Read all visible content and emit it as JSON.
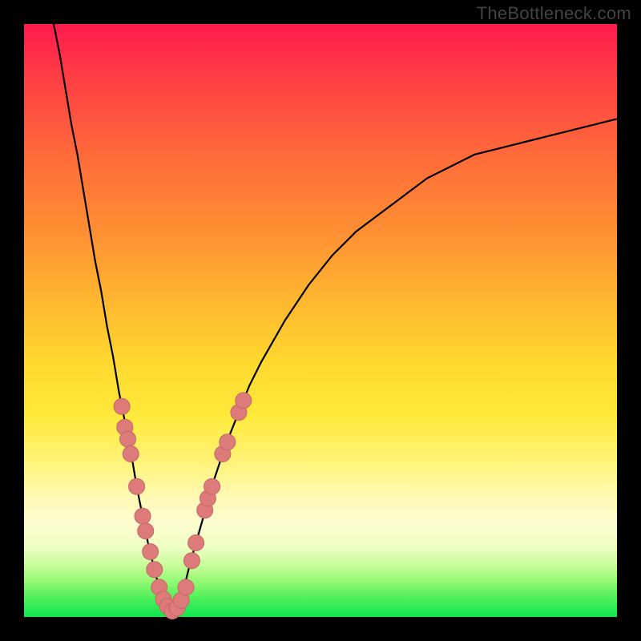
{
  "watermark": "TheBottleneck.com",
  "colors": {
    "curve": "#000000",
    "marker_fill": "#dd7a7a",
    "marker_stroke": "#c76666",
    "frame": "#000000"
  },
  "chart_data": {
    "type": "line",
    "title": "",
    "xlabel": "",
    "ylabel": "",
    "xlim": [
      0,
      100
    ],
    "ylim": [
      0,
      100
    ],
    "series": [
      {
        "name": "bottleneck-curve",
        "x": [
          5,
          6,
          7,
          8,
          9,
          10,
          11,
          12,
          13,
          14,
          15,
          16,
          17,
          18,
          19,
          20,
          21,
          22,
          23,
          24,
          25,
          26,
          27,
          28,
          30,
          32,
          34,
          36,
          38,
          40,
          44,
          48,
          52,
          56,
          60,
          64,
          68,
          72,
          76,
          80,
          84,
          88,
          92,
          96,
          100
        ],
        "values": [
          100,
          95,
          89,
          83,
          78,
          72,
          66,
          60,
          55,
          49,
          44,
          38,
          33,
          28,
          22,
          17,
          12,
          8,
          4,
          2,
          1,
          2,
          5,
          9,
          16,
          23,
          29,
          34,
          39,
          43,
          50,
          56,
          61,
          65,
          68,
          71,
          74,
          76,
          78,
          79,
          80,
          81,
          82,
          83,
          84
        ]
      }
    ],
    "markers": [
      {
        "x": 16.5,
        "y": 35.5
      },
      {
        "x": 17.0,
        "y": 32.0
      },
      {
        "x": 17.5,
        "y": 30.0
      },
      {
        "x": 18.0,
        "y": 27.5
      },
      {
        "x": 19.0,
        "y": 22.0
      },
      {
        "x": 20.0,
        "y": 17.0
      },
      {
        "x": 20.5,
        "y": 14.5
      },
      {
        "x": 21.3,
        "y": 11.0
      },
      {
        "x": 22.0,
        "y": 8.0
      },
      {
        "x": 22.8,
        "y": 5.0
      },
      {
        "x": 23.5,
        "y": 3.0
      },
      {
        "x": 24.2,
        "y": 1.8
      },
      {
        "x": 25.0,
        "y": 1.0
      },
      {
        "x": 25.8,
        "y": 1.5
      },
      {
        "x": 26.5,
        "y": 2.8
      },
      {
        "x": 27.3,
        "y": 5.0
      },
      {
        "x": 28.3,
        "y": 9.5
      },
      {
        "x": 29.0,
        "y": 12.5
      },
      {
        "x": 30.5,
        "y": 18.0
      },
      {
        "x": 31.0,
        "y": 20.0
      },
      {
        "x": 31.7,
        "y": 22.0
      },
      {
        "x": 33.5,
        "y": 27.5
      },
      {
        "x": 34.3,
        "y": 29.5
      },
      {
        "x": 36.2,
        "y": 34.5
      },
      {
        "x": 37.0,
        "y": 36.5
      }
    ]
  }
}
